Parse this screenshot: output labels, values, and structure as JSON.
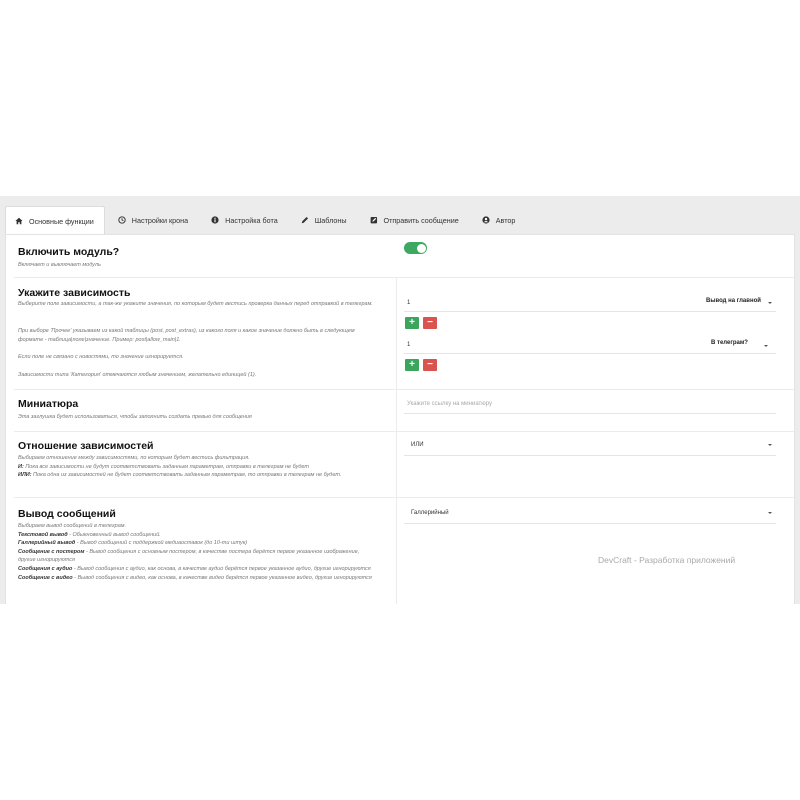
{
  "tabs": [
    {
      "label": "Основные функции",
      "icon": "home-icon",
      "active": true
    },
    {
      "label": "Настройки крона",
      "icon": "clock-icon",
      "active": false
    },
    {
      "label": "Настройка бота",
      "icon": "info-icon",
      "active": false
    },
    {
      "label": "Шаблоны",
      "icon": "pencil-icon",
      "active": false
    },
    {
      "label": "Отправить сообщение",
      "icon": "edit-square-icon",
      "active": false
    },
    {
      "label": "Автор",
      "icon": "user-circle-icon",
      "active": false
    }
  ],
  "module": {
    "title": "Включить модуль?",
    "desc": "Включает и выключает модуль",
    "enabled": true
  },
  "deps": {
    "title": "Укажите зависимость",
    "p1": "Выберите поле зависимости, а так-же укажите значения, по которым будет вестись проверка данных перед отправкой в телеграм.",
    "p2": "При выборе 'Прочее' указываем из какой таблицы (post, post_extras), из какого поля и какое значение должно быть в следующем формате - таблица|поле|значение. Пример: post|allow_main|1.",
    "p3": "Если поле не связано с новостями, то значение игнорируется.",
    "p4": "Зависимости типа 'Категория' отмечаются любым значением, желательно единицей (1).",
    "rows": [
      {
        "value": "1",
        "select": "Вывод на главной"
      },
      {
        "value": "1",
        "select": "В телеграм?"
      }
    ],
    "plus_label": "+",
    "minus_label": "−"
  },
  "thumb": {
    "title": "Миниатюра",
    "desc": "Эта заглушка будет использоваться, чтобы заполнить создать превью для сообщения",
    "placeholder": "Укажите ссылку на миниатюру"
  },
  "relation": {
    "title": "Отношение зависимостей",
    "l1": "Выбираем отношение между зависимостями, по которым будет вестись фильтрация.",
    "l2_b": "И:",
    "l2": " Пока все зависимости не будут соответствовать заданным параметрам, отправки в телеграм не будет",
    "l3_b": "ИЛИ:",
    "l3": " Пока одна из зависимостей не будет соответствовать заданным параметрам, то отправки в телеграм не будет.",
    "value": "ИЛИ"
  },
  "output": {
    "title": "Вывод сообщений",
    "l0": "Выбираем вывод сообщений в телеграм.",
    "items": [
      {
        "b": "Текстовой вывод",
        "t": " - Обыкновенный вывод сообщений."
      },
      {
        "b": "Галлерийный вывод",
        "t": " - Вывод сообщений с поддержкой медиаоставок (до 10-ти штук)"
      },
      {
        "b": "Сообщение с постером",
        "t": " - Вывод сообщения с основным постером, в качестве постера берётся первое указанное изображение, другие игнорируются"
      },
      {
        "b": "Сообщения с аудио",
        "t": " - Вывод сообщения с аудио, как основа, в качестве аудио берётся первое указанное аудио, другие игнорируются"
      },
      {
        "b": "Сообщение с видео",
        "t": " - Вывод сообщения с видео, как основа, в качестве видео берётся первое указанное видео, другие игнорируются"
      }
    ],
    "value": "Галлерийный"
  },
  "watermark": "DevCraft - Разработка приложений",
  "colors": {
    "accent_green": "#3da862",
    "plus_green": "#3ba55c",
    "minus_red": "#d9534f"
  }
}
